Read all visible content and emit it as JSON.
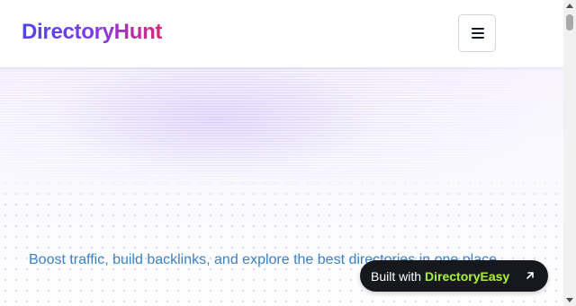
{
  "header": {
    "logo": "DirectoryHunt",
    "menu_icon": "hamburger-menu-icon"
  },
  "hero": {
    "subtitle": "Boost traffic, build backlinks, and explore the best directories in one place."
  },
  "badge": {
    "prefix": "Built with",
    "brand": "DirectoryEasy",
    "icon": "arrow-up-right-icon"
  },
  "colors": {
    "logo_gradient": [
      "#4f46e5",
      "#7c3aed",
      "#db2777"
    ],
    "subtitle": "#3b82c4",
    "badge_bg": "#16181d",
    "badge_brand": "#a3e635"
  }
}
